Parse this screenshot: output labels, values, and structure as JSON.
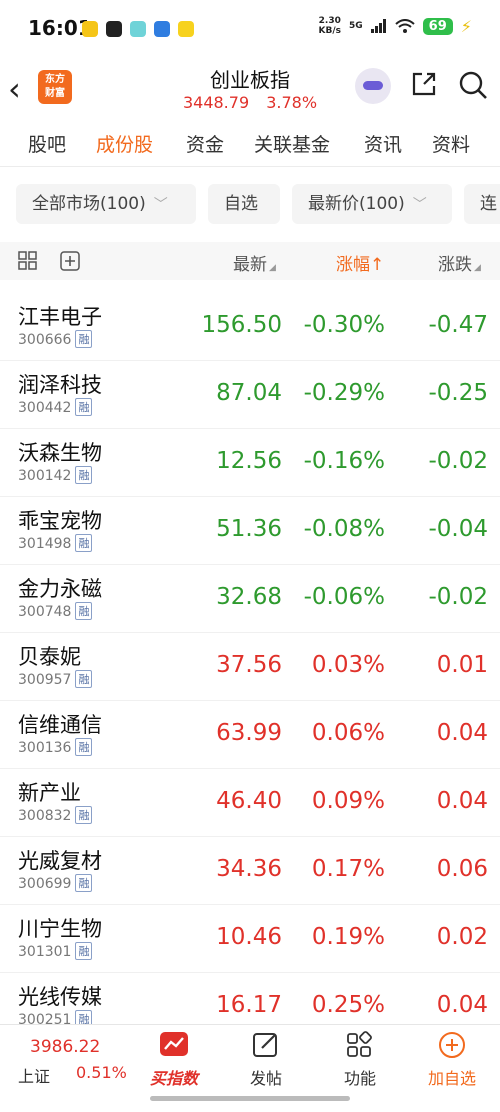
{
  "status_bar": {
    "time": "16:01",
    "speed_value": "2.30",
    "speed_unit": "KB/s",
    "network": "5G",
    "battery": "69"
  },
  "header": {
    "logo_text": "东方\n财富",
    "title": "创业板指",
    "price": "3448.79",
    "change_pct": "3.78%"
  },
  "tabs": [
    {
      "label": "股吧"
    },
    {
      "label": "成份股"
    },
    {
      "label": "资金"
    },
    {
      "label": "关联基金"
    },
    {
      "label": "资讯"
    },
    {
      "label": "资料"
    }
  ],
  "filters": {
    "market": "全部市场(100)",
    "watchlist": "自选",
    "latest_price": "最新价(100)",
    "more": "连"
  },
  "table_header": {
    "latest": "最新",
    "change_pct": "涨幅↑",
    "change": "涨跌"
  },
  "rows": [
    {
      "name": "江丰电子",
      "code": "300666",
      "tag": "融",
      "price": "156.50",
      "pct": "-0.30%",
      "chg": "-0.47"
    },
    {
      "name": "润泽科技",
      "code": "300442",
      "tag": "融",
      "price": "87.04",
      "pct": "-0.29%",
      "chg": "-0.25"
    },
    {
      "name": "沃森生物",
      "code": "300142",
      "tag": "融",
      "price": "12.56",
      "pct": "-0.16%",
      "chg": "-0.02"
    },
    {
      "name": "乖宝宠物",
      "code": "301498",
      "tag": "融",
      "price": "51.36",
      "pct": "-0.08%",
      "chg": "-0.04"
    },
    {
      "name": "金力永磁",
      "code": "300748",
      "tag": "融",
      "price": "32.68",
      "pct": "-0.06%",
      "chg": "-0.02"
    },
    {
      "name": "贝泰妮",
      "code": "300957",
      "tag": "融",
      "price": "37.56",
      "pct": "0.03%",
      "chg": "0.01"
    },
    {
      "name": "信维通信",
      "code": "300136",
      "tag": "融",
      "price": "63.99",
      "pct": "0.06%",
      "chg": "0.04"
    },
    {
      "name": "新产业",
      "code": "300832",
      "tag": "融",
      "price": "46.40",
      "pct": "0.09%",
      "chg": "0.04"
    },
    {
      "name": "光威复材",
      "code": "300699",
      "tag": "融",
      "price": "34.36",
      "pct": "0.17%",
      "chg": "0.06"
    },
    {
      "name": "川宁生物",
      "code": "301301",
      "tag": "融",
      "price": "10.46",
      "pct": "0.19%",
      "chg": "0.02"
    },
    {
      "name": "光线传媒",
      "code": "300251",
      "tag": "融",
      "price": "16.17",
      "pct": "0.25%",
      "chg": "0.04"
    }
  ],
  "bottom_bar": {
    "index_value": "3986.22",
    "index_name": "上证",
    "index_pct": "0.51%",
    "buy_index": "买指数",
    "post": "发帖",
    "features": "功能",
    "add_watch": "加自选"
  },
  "colors": {
    "accent": "#f26a1e",
    "up": "#e0312a",
    "down": "#2e9a2e"
  }
}
